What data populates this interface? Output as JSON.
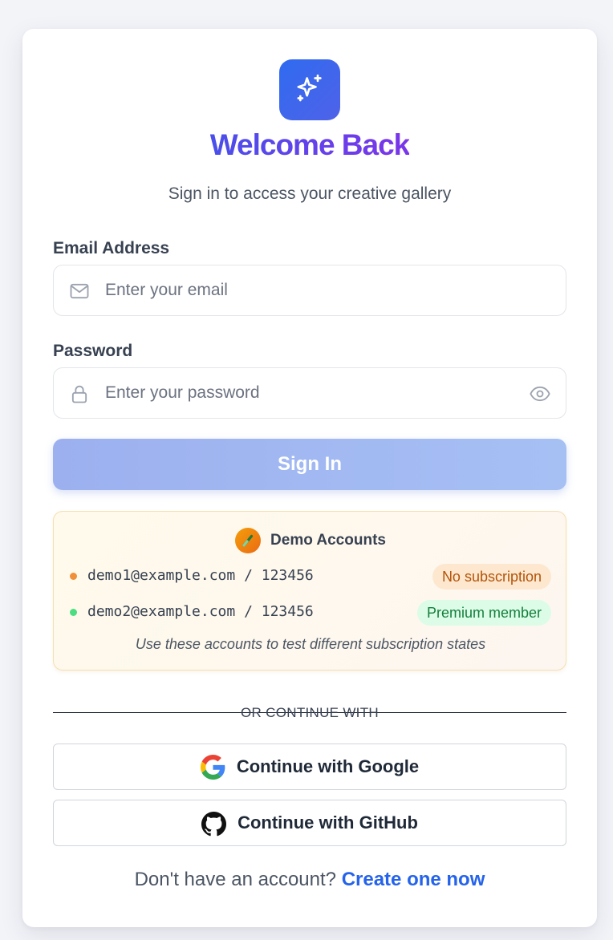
{
  "header": {
    "logo_icon": "sparkles-icon",
    "title": "Welcome Back",
    "subtitle": "Sign in to access your creative gallery"
  },
  "form": {
    "email": {
      "label": "Email Address",
      "placeholder": "Enter your email",
      "value": "",
      "icon": "mail-icon"
    },
    "password": {
      "label": "Password",
      "placeholder": "Enter your password",
      "value": "",
      "icon": "lock-icon",
      "toggle_icon": "eye-icon"
    },
    "submit_label": "Sign In"
  },
  "demo": {
    "title": "Demo Accounts",
    "icon": "test-tube-emoji",
    "accounts": [
      {
        "credentials": "demo1@example.com / 123456",
        "status": "No subscription",
        "dot_color": "#f0903a"
      },
      {
        "credentials": "demo2@example.com / 123456",
        "status": "Premium member",
        "dot_color": "#4ade80"
      }
    ],
    "note": "Use these accounts to test different subscription states"
  },
  "divider_text": "OR CONTINUE WITH",
  "oauth": {
    "google_label": "Continue with Google",
    "github_label": "Continue with GitHub"
  },
  "footer": {
    "prompt": "Don't have an account? ",
    "link": "Create one now"
  },
  "colors": {
    "accent": "#2563eb",
    "title_gradient_start": "#4a4fea",
    "title_gradient_end": "#7b35e9",
    "button_fill": "#a3b8f1"
  }
}
